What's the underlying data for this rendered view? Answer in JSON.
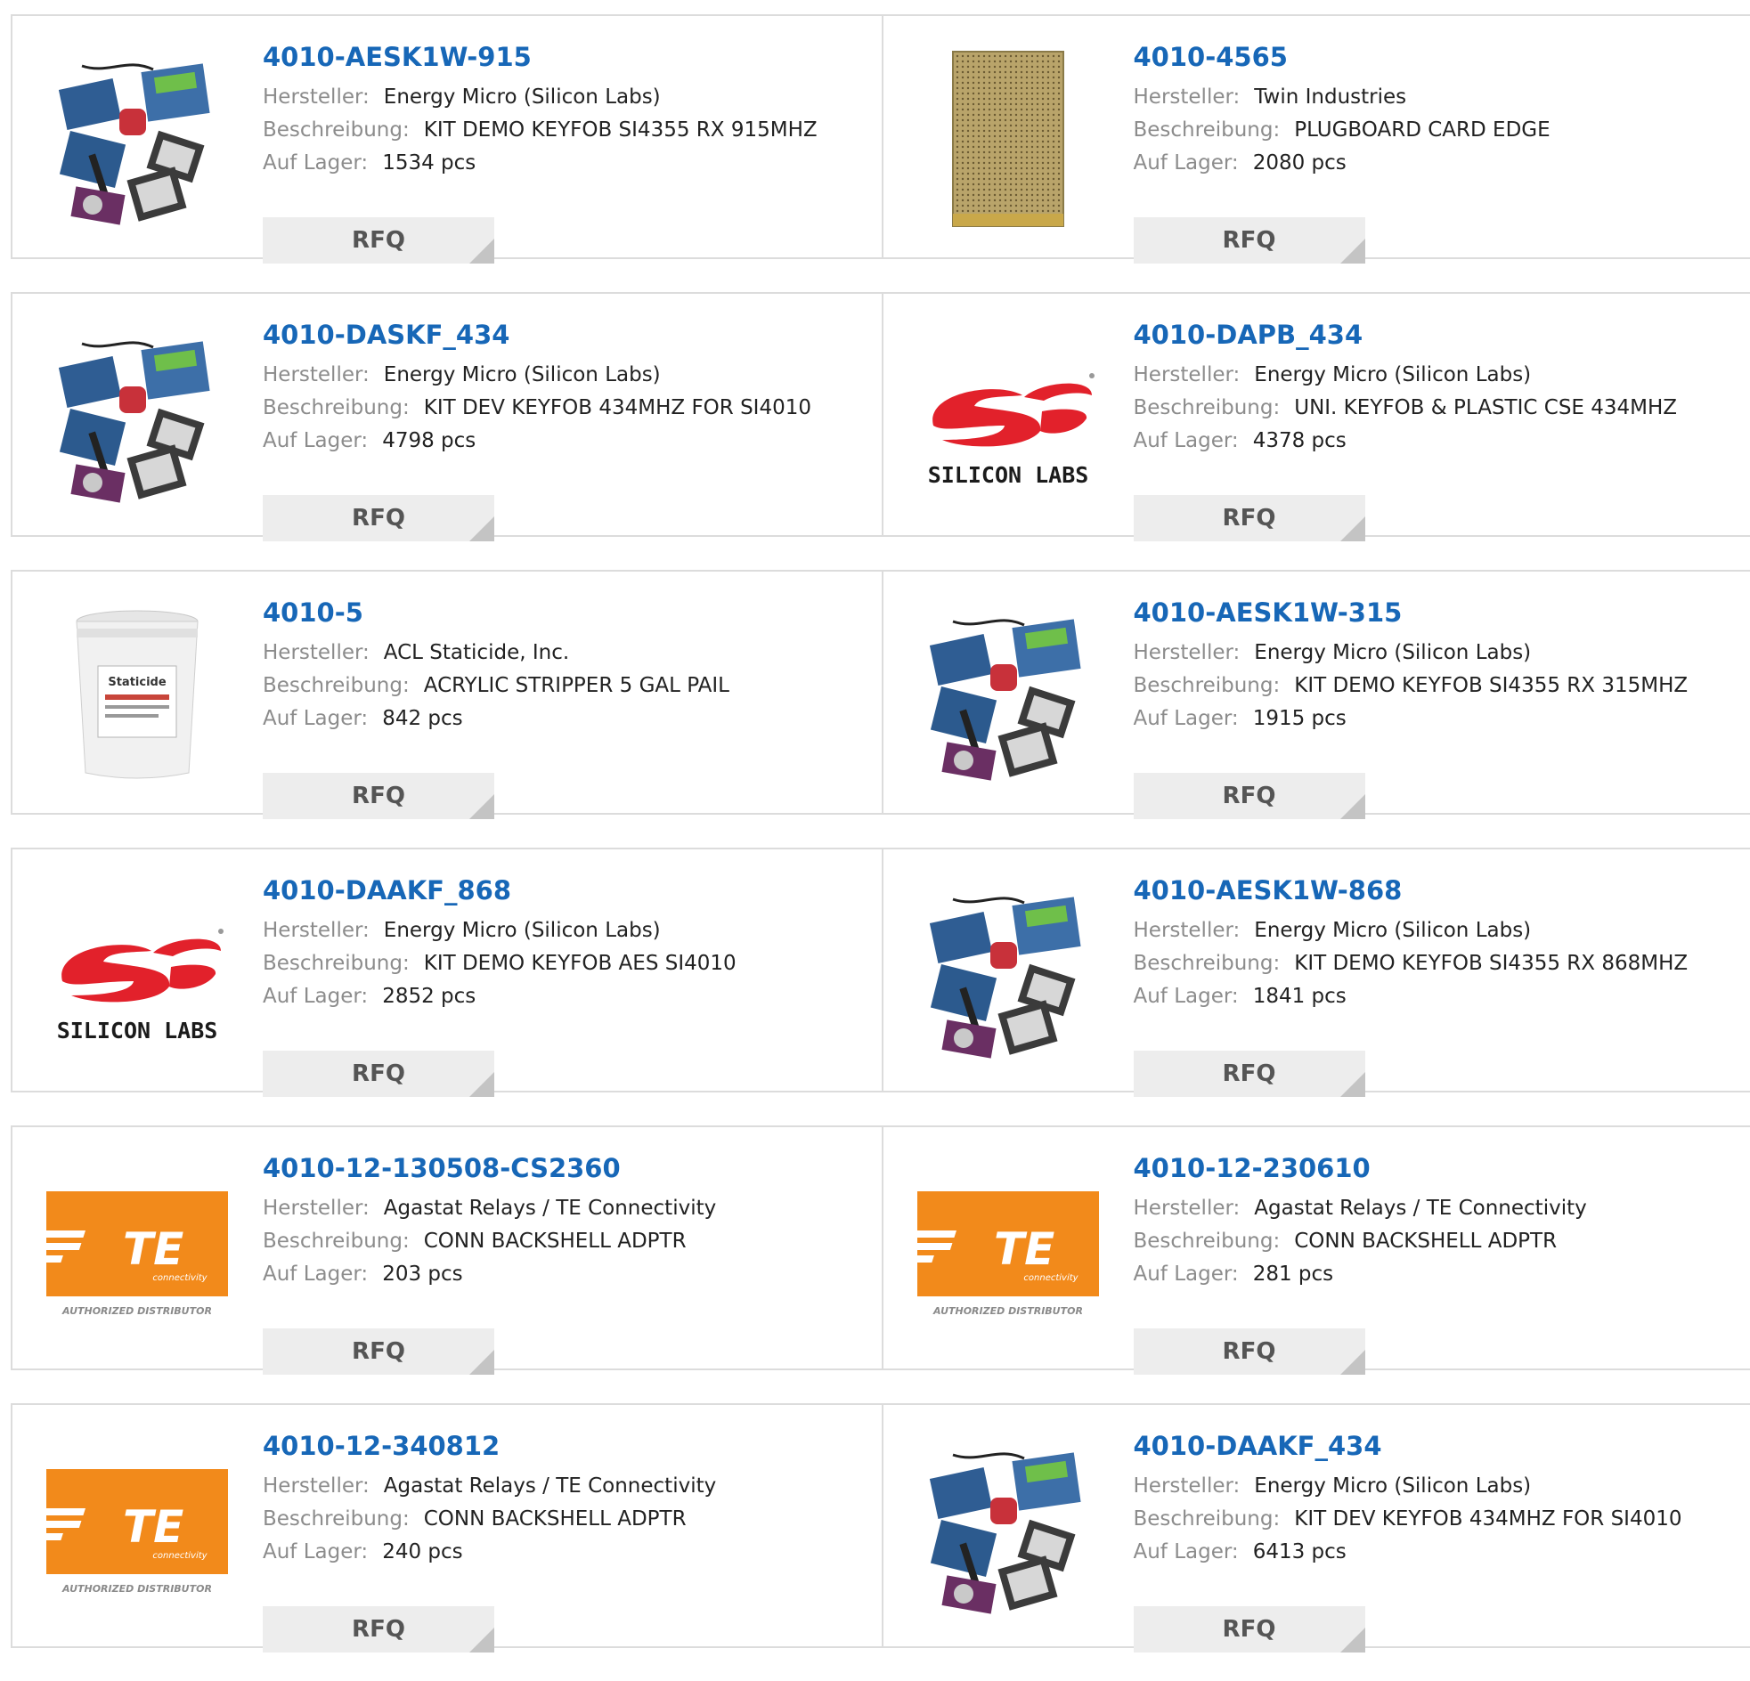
{
  "labels": {
    "manufacturer": "Hersteller:",
    "description": "Beschreibung:",
    "stock": "Auf Lager:",
    "rfq": "RFQ"
  },
  "colors": {
    "link": "#1767b7",
    "label": "#8c8c8c",
    "value": "#222222",
    "button_bg": "#ededed",
    "border": "#dcdcdc"
  },
  "products": [
    {
      "part": "4010-AESK1W-915",
      "manufacturer": "Energy Micro (Silicon Labs)",
      "description": "KIT DEMO KEYFOB SI4355 RX 915MHZ",
      "stock": "1534 pcs",
      "image": "dev-kit-photo"
    },
    {
      "part": "4010-4565",
      "manufacturer": "Twin Industries",
      "description": "PLUGBOARD CARD EDGE",
      "stock": "2080 pcs",
      "image": "plugboard-photo"
    },
    {
      "part": "4010-DASKF_434",
      "manufacturer": "Energy Micro (Silicon Labs)",
      "description": "KIT DEV KEYFOB 434MHZ FOR SI4010",
      "stock": "4798 pcs",
      "image": "dev-kit-photo"
    },
    {
      "part": "4010-DAPB_434",
      "manufacturer": "Energy Micro (Silicon Labs)",
      "description": "UNI. KEYFOB & PLASTIC CSE 434MHZ",
      "stock": "4378 pcs",
      "image": "silicon-labs-logo",
      "logo_text": "SILICON LABS"
    },
    {
      "part": "4010-5",
      "manufacturer": "ACL Staticide, Inc.",
      "description": "ACRYLIC STRIPPER 5 GAL PAIL",
      "stock": "842 pcs",
      "image": "bucket-photo",
      "logo_text": "Staticide"
    },
    {
      "part": "4010-AESK1W-315",
      "manufacturer": "Energy Micro (Silicon Labs)",
      "description": "KIT DEMO KEYFOB SI4355 RX 315MHZ",
      "stock": "1915 pcs",
      "image": "dev-kit-photo"
    },
    {
      "part": "4010-DAAKF_868",
      "manufacturer": "Energy Micro (Silicon Labs)",
      "description": "KIT DEMO KEYFOB AES SI4010",
      "stock": "2852 pcs",
      "image": "silicon-labs-logo",
      "logo_text": "SILICON LABS"
    },
    {
      "part": "4010-AESK1W-868",
      "manufacturer": "Energy Micro (Silicon Labs)",
      "description": "KIT DEMO KEYFOB SI4355 RX 868MHZ",
      "stock": "1841 pcs",
      "image": "dev-kit-photo"
    },
    {
      "part": "4010-12-130508-CS2360",
      "manufacturer": "Agastat Relays / TE Connectivity",
      "description": "CONN BACKSHELL ADPTR",
      "stock": "203 pcs",
      "image": "te-logo",
      "logo_text": "TE",
      "logo_sub": "connectivity",
      "logo_caption": "AUTHORIZED DISTRIBUTOR"
    },
    {
      "part": "4010-12-230610",
      "manufacturer": "Agastat Relays / TE Connectivity",
      "description": "CONN BACKSHELL ADPTR",
      "stock": "281 pcs",
      "image": "te-logo",
      "logo_text": "TE",
      "logo_sub": "connectivity",
      "logo_caption": "AUTHORIZED DISTRIBUTOR"
    },
    {
      "part": "4010-12-340812",
      "manufacturer": "Agastat Relays / TE Connectivity",
      "description": "CONN BACKSHELL ADPTR",
      "stock": "240 pcs",
      "image": "te-logo",
      "logo_text": "TE",
      "logo_sub": "connectivity",
      "logo_caption": "AUTHORIZED DISTRIBUTOR"
    },
    {
      "part": "4010-DAAKF_434",
      "manufacturer": "Energy Micro (Silicon Labs)",
      "description": "KIT DEV KEYFOB 434MHZ FOR SI4010",
      "stock": "6413 pcs",
      "image": "dev-kit-photo"
    }
  ]
}
